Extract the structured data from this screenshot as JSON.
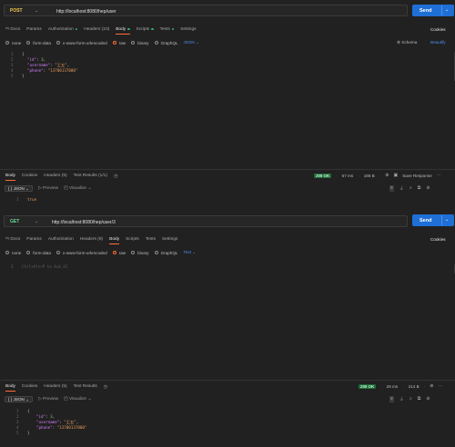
{
  "req1": {
    "method": "POST",
    "url": "http://localhost:8080/hep/user",
    "send": "Send",
    "tabs": [
      "Docs",
      "Params",
      "Authorization",
      "Headers (10)",
      "Body",
      "Scripts",
      "Tests",
      "Settings"
    ],
    "cookies": "Cookies",
    "body_modes": [
      "none",
      "form-data",
      "x-www-form-urlencoded",
      "raw",
      "binary",
      "GraphQL"
    ],
    "format": "JSON",
    "schema": "Schema",
    "beautify": "Beautify",
    "lines": [
      "1",
      "2",
      "3",
      "4",
      "5"
    ],
    "code": {
      "open": "{",
      "id_key": "\"id\"",
      "id_val": "3",
      "user_key": "\"username\"",
      "user_val": "\"王五\"",
      "phone_key": "\"phone\"",
      "phone_val": "\"13700137000\"",
      "close": "}"
    }
  },
  "resp1": {
    "tabs": [
      "Body",
      "Cookies",
      "Headers (5)",
      "Test Results (1/1)"
    ],
    "status": "200 OK",
    "time": "67 ms",
    "size": "168 B",
    "save": "Save Response",
    "format": "{ } JSON",
    "preview": "Preview",
    "visualize": "Visualize",
    "line": "1",
    "value": "true"
  },
  "req2": {
    "method": "GET",
    "url": "http://localhost:8080/hep/user/3",
    "send": "Send",
    "tabs": [
      "Docs",
      "Params",
      "Authorization",
      "Headers (8)",
      "Body",
      "Scripts",
      "Tests",
      "Settings"
    ],
    "cookies": "Cookies",
    "body_modes": [
      "none",
      "form-data",
      "x-www-form-urlencoded",
      "raw",
      "binary",
      "GraphQL"
    ],
    "format": "Text",
    "line": "1",
    "placeholder": "Ctrl+Alt+P to Ask AI"
  },
  "resp2": {
    "tabs": [
      "Body",
      "Cookies",
      "Headers (5)",
      "Test Results"
    ],
    "status": "200 OK",
    "time": "28 ms",
    "size": "214 B",
    "format": "{ } JSON",
    "preview": "Preview",
    "visualize": "Visualize",
    "lines": [
      "1",
      "2",
      "3",
      "4",
      "5"
    ],
    "code": {
      "open": "{",
      "id_key": "\"id\"",
      "id_val": "3",
      "user_key": "\"username\"",
      "user_val": "\"王五\"",
      "phone_key": "\"phone\"",
      "phone_val": "\"13700137000\"",
      "close": "}"
    }
  },
  "colors": {
    "accent": "#ff6c37",
    "send": "#1f6fd6",
    "ok": "#1f6b3a",
    "post": "#f2c94c",
    "get": "#6bdd9a"
  },
  "icons": [
    "chevron-down-icon",
    "history-icon",
    "globe-icon",
    "save-icon",
    "wrap-icon",
    "filter-icon",
    "search-icon",
    "copy-icon",
    "link-icon",
    "schema-icon",
    "preview-icon",
    "visualize-icon"
  ]
}
